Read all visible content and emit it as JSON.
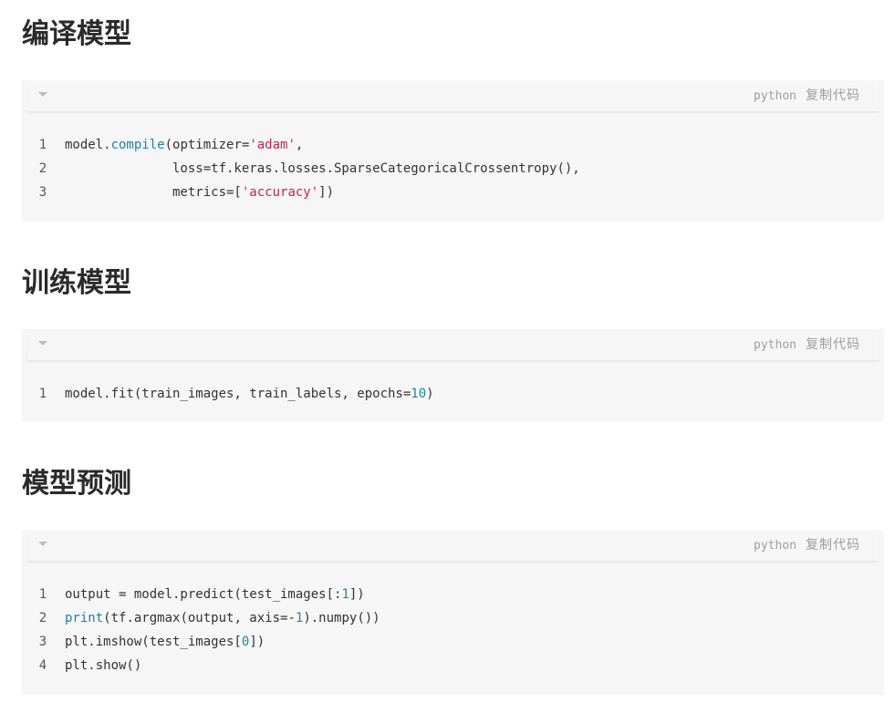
{
  "sections": [
    {
      "title": "编译模型",
      "lang": "python",
      "copy_label": "复制代码",
      "lines": [
        [
          {
            "t": "model."
          },
          {
            "t": "compile",
            "c": "fn"
          },
          {
            "t": "(optimizer="
          },
          {
            "t": "'adam'",
            "c": "str"
          },
          {
            "t": ","
          }
        ],
        [
          {
            "t": "              loss=tf.keras.losses.SparseCategoricalCrossentropy(),"
          }
        ],
        [
          {
            "t": "              metrics=["
          },
          {
            "t": "'accuracy'",
            "c": "str"
          },
          {
            "t": "])"
          }
        ]
      ]
    },
    {
      "title": "训练模型",
      "lang": "python",
      "copy_label": "复制代码",
      "lines": [
        [
          {
            "t": "model.fit(train_images, train_labels, epochs="
          },
          {
            "t": "10",
            "c": "num"
          },
          {
            "t": ")"
          }
        ]
      ]
    },
    {
      "title": "模型预测",
      "lang": "python",
      "copy_label": "复制代码",
      "lines": [
        [
          {
            "t": "output = model.predict(test_images[:"
          },
          {
            "t": "1",
            "c": "num"
          },
          {
            "t": "])"
          }
        ],
        [
          {
            "t": "print",
            "c": "fn"
          },
          {
            "t": "(tf.argmax(output, axis=-"
          },
          {
            "t": "1",
            "c": "num"
          },
          {
            "t": ").numpy())"
          }
        ],
        [
          {
            "t": "plt.imshow(test_images["
          },
          {
            "t": "0",
            "c": "num"
          },
          {
            "t": "])"
          }
        ],
        [
          {
            "t": "plt.show()"
          }
        ]
      ]
    }
  ],
  "colors": {
    "function": "#1a82a8",
    "string": "#c7254e",
    "number": "#1a8a99",
    "code_background": "#f6f6f6"
  },
  "icons": {
    "collapse": "chevron-down-icon"
  }
}
